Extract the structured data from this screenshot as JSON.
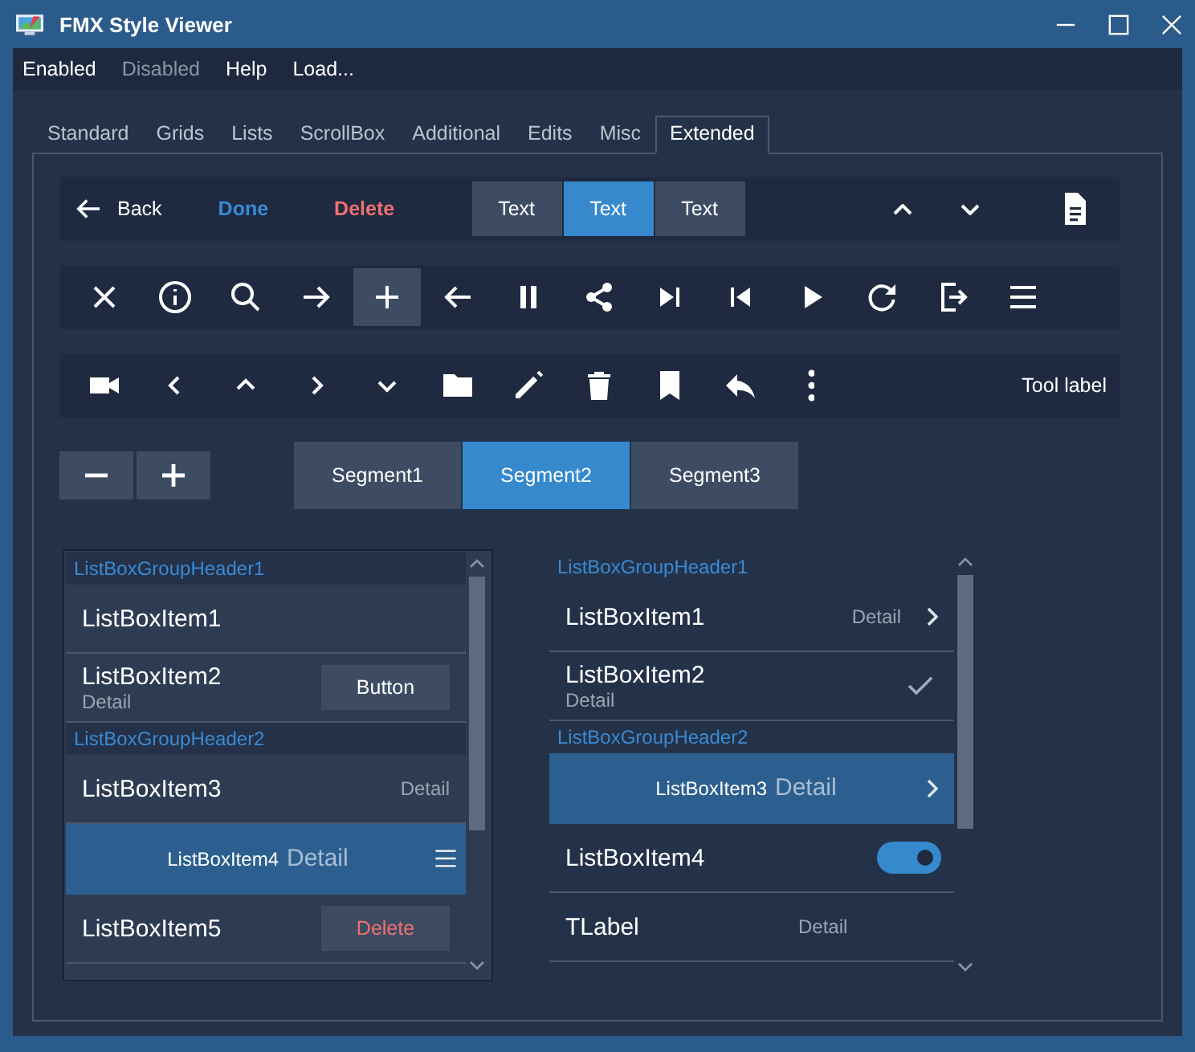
{
  "window": {
    "title": "FMX Style Viewer"
  },
  "menu": [
    {
      "label": "Enabled",
      "disabled": false
    },
    {
      "label": "Disabled",
      "disabled": true
    },
    {
      "label": "Help",
      "disabled": false
    },
    {
      "label": "Load...",
      "disabled": false
    }
  ],
  "tabs": [
    {
      "label": "Standard",
      "selected": false
    },
    {
      "label": "Grids",
      "selected": false
    },
    {
      "label": "Lists",
      "selected": false
    },
    {
      "label": "ScrollBox",
      "selected": false
    },
    {
      "label": "Additional",
      "selected": false
    },
    {
      "label": "Edits",
      "selected": false
    },
    {
      "label": "Misc",
      "selected": false
    },
    {
      "label": "Extended",
      "selected": true
    }
  ],
  "top_toolbar": {
    "back": "Back",
    "done": "Done",
    "delete": "Delete",
    "segments": [
      {
        "label": "Text",
        "selected": false
      },
      {
        "label": "Text",
        "selected": true
      },
      {
        "label": "Text",
        "selected": false
      }
    ]
  },
  "icon_toolbar": {
    "buttons": [
      {
        "kind": "close",
        "selected": false
      },
      {
        "kind": "info",
        "selected": false
      },
      {
        "kind": "search",
        "selected": false
      },
      {
        "kind": "arrow-right",
        "selected": false
      },
      {
        "kind": "plus",
        "selected": true
      },
      {
        "kind": "arrow-left",
        "selected": false
      },
      {
        "kind": "pause",
        "selected": false
      },
      {
        "kind": "share",
        "selected": false
      },
      {
        "kind": "skip-next",
        "selected": false
      },
      {
        "kind": "skip-previous",
        "selected": false
      },
      {
        "kind": "play",
        "selected": false
      },
      {
        "kind": "refresh",
        "selected": false
      },
      {
        "kind": "exit",
        "selected": false
      },
      {
        "kind": "menu",
        "selected": false
      }
    ]
  },
  "icon_toolbar_2": {
    "buttons": [
      {
        "kind": "video-camera",
        "selected": false
      },
      {
        "kind": "chevron-left",
        "selected": false
      },
      {
        "kind": "chevron-up",
        "selected": false
      },
      {
        "kind": "chevron-right",
        "selected": false
      },
      {
        "kind": "chevron-down",
        "selected": false
      },
      {
        "kind": "folder",
        "selected": false
      },
      {
        "kind": "pencil",
        "selected": false
      },
      {
        "kind": "trash",
        "selected": false
      },
      {
        "kind": "bookmark",
        "selected": false
      },
      {
        "kind": "reply",
        "selected": false
      },
      {
        "kind": "more",
        "selected": false
      }
    ],
    "label": "Tool label"
  },
  "segments": [
    {
      "label": "Segment1",
      "selected": false
    },
    {
      "label": "Segment2",
      "selected": true
    },
    {
      "label": "Segment3",
      "selected": false
    }
  ],
  "left_list": {
    "items": [
      {
        "kind": "header",
        "text": "ListBoxGroupHeader1"
      },
      {
        "kind": "plain",
        "text": "ListBoxItem1",
        "selected": false
      },
      {
        "kind": "subtitle-button",
        "text": "ListBoxItem2",
        "detail": "Detail",
        "button": "Button",
        "selected": false
      },
      {
        "kind": "header",
        "text": "ListBoxGroupHeader2"
      },
      {
        "kind": "right-detail",
        "text": "ListBoxItem3",
        "detail": "Detail",
        "selected": false
      },
      {
        "kind": "centered-menu",
        "text": "ListBoxItem4",
        "detail": "Detail",
        "selected": true
      },
      {
        "kind": "delete",
        "text": "ListBoxItem5",
        "button": "Delete",
        "selected": false
      }
    ]
  },
  "right_list": {
    "items": [
      {
        "kind": "header",
        "text": "ListBoxGroupHeader1"
      },
      {
        "kind": "right-detail-chevron",
        "text": "ListBoxItem1",
        "detail": "Detail",
        "selected": false
      },
      {
        "kind": "subtitle",
        "text": "ListBoxItem2",
        "detail": "Detail",
        "checked": true,
        "selected": false
      },
      {
        "kind": "header",
        "text": "ListBoxGroupHeader2"
      },
      {
        "kind": "centered-chevron",
        "text": "ListBoxItem3",
        "detail": "Detail",
        "selected": true
      },
      {
        "kind": "switch",
        "text": "ListBoxItem4",
        "on": true,
        "selected": false
      },
      {
        "kind": "label",
        "text": "TLabel",
        "detail": "Detail",
        "selected": false
      }
    ]
  }
}
